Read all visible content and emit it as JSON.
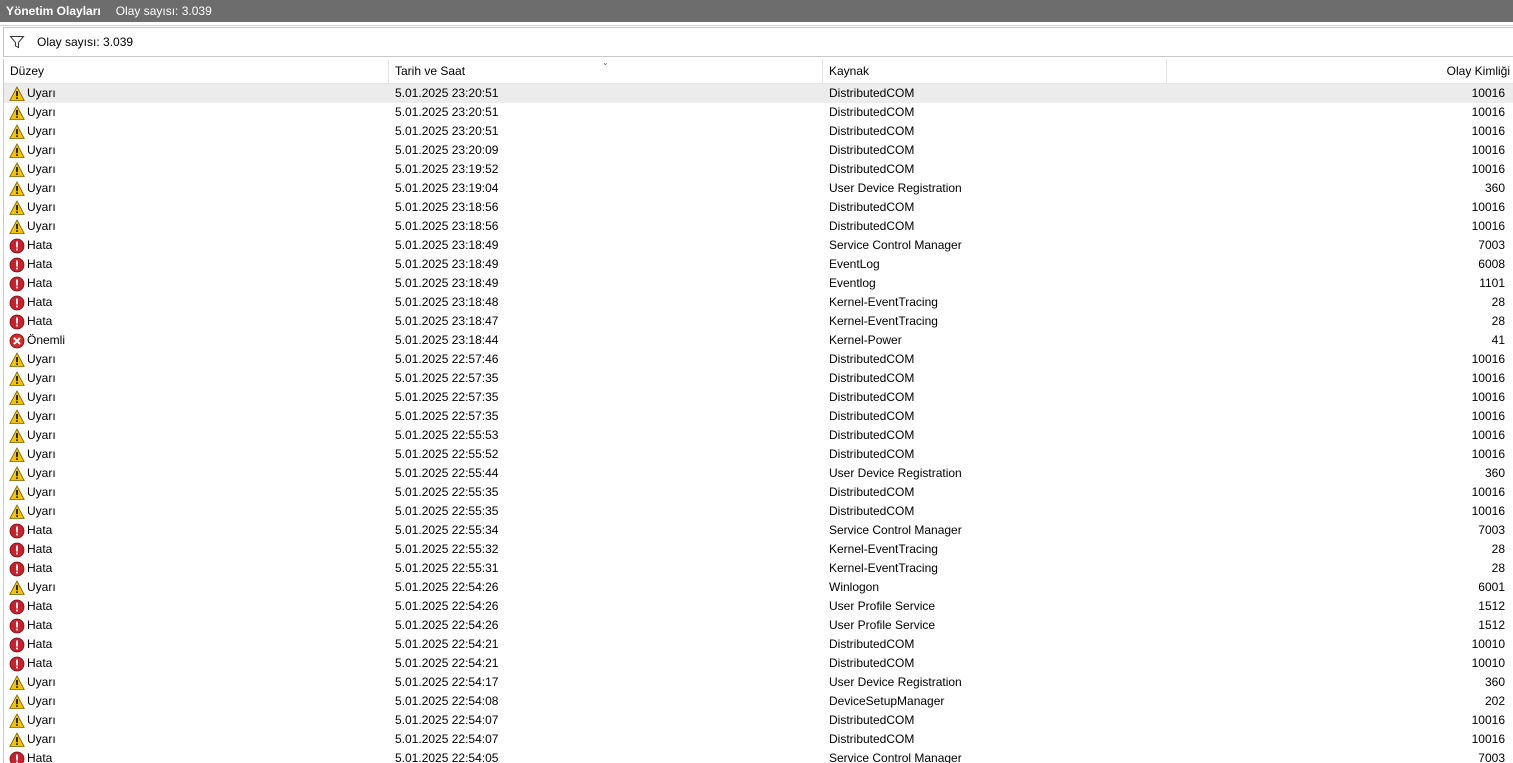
{
  "titlebar": {
    "title": "Yönetim Olayları",
    "count": "Olay sayısı: 3.039"
  },
  "filterbar": {
    "icon": "filter-icon",
    "text": "Olay sayısı: 3.039"
  },
  "columns": {
    "level": "Düzey",
    "date": "Tarih ve Saat",
    "source": "Kaynak",
    "id": "Olay Kimliği"
  },
  "icon_map": {
    "Uyarı": "warning",
    "Hata": "error",
    "Önemli": "critical"
  },
  "colors": {
    "warning": "#f5c400",
    "error": "#c8202c",
    "critical": "#d42a2a"
  },
  "rows": [
    {
      "level": "Uyarı",
      "date": "5.01.2025 23:20:51",
      "source": "DistributedCOM",
      "id": "10016"
    },
    {
      "level": "Uyarı",
      "date": "5.01.2025 23:20:51",
      "source": "DistributedCOM",
      "id": "10016"
    },
    {
      "level": "Uyarı",
      "date": "5.01.2025 23:20:51",
      "source": "DistributedCOM",
      "id": "10016"
    },
    {
      "level": "Uyarı",
      "date": "5.01.2025 23:20:09",
      "source": "DistributedCOM",
      "id": "10016"
    },
    {
      "level": "Uyarı",
      "date": "5.01.2025 23:19:52",
      "source": "DistributedCOM",
      "id": "10016"
    },
    {
      "level": "Uyarı",
      "date": "5.01.2025 23:19:04",
      "source": "User Device Registration",
      "id": "360"
    },
    {
      "level": "Uyarı",
      "date": "5.01.2025 23:18:56",
      "source": "DistributedCOM",
      "id": "10016"
    },
    {
      "level": "Uyarı",
      "date": "5.01.2025 23:18:56",
      "source": "DistributedCOM",
      "id": "10016"
    },
    {
      "level": "Hata",
      "date": "5.01.2025 23:18:49",
      "source": "Service Control Manager",
      "id": "7003"
    },
    {
      "level": "Hata",
      "date": "5.01.2025 23:18:49",
      "source": "EventLog",
      "id": "6008"
    },
    {
      "level": "Hata",
      "date": "5.01.2025 23:18:49",
      "source": "Eventlog",
      "id": "1101"
    },
    {
      "level": "Hata",
      "date": "5.01.2025 23:18:48",
      "source": "Kernel-EventTracing",
      "id": "28"
    },
    {
      "level": "Hata",
      "date": "5.01.2025 23:18:47",
      "source": "Kernel-EventTracing",
      "id": "28"
    },
    {
      "level": "Önemli",
      "date": "5.01.2025 23:18:44",
      "source": "Kernel-Power",
      "id": "41"
    },
    {
      "level": "Uyarı",
      "date": "5.01.2025 22:57:46",
      "source": "DistributedCOM",
      "id": "10016"
    },
    {
      "level": "Uyarı",
      "date": "5.01.2025 22:57:35",
      "source": "DistributedCOM",
      "id": "10016"
    },
    {
      "level": "Uyarı",
      "date": "5.01.2025 22:57:35",
      "source": "DistributedCOM",
      "id": "10016"
    },
    {
      "level": "Uyarı",
      "date": "5.01.2025 22:57:35",
      "source": "DistributedCOM",
      "id": "10016"
    },
    {
      "level": "Uyarı",
      "date": "5.01.2025 22:55:53",
      "source": "DistributedCOM",
      "id": "10016"
    },
    {
      "level": "Uyarı",
      "date": "5.01.2025 22:55:52",
      "source": "DistributedCOM",
      "id": "10016"
    },
    {
      "level": "Uyarı",
      "date": "5.01.2025 22:55:44",
      "source": "User Device Registration",
      "id": "360"
    },
    {
      "level": "Uyarı",
      "date": "5.01.2025 22:55:35",
      "source": "DistributedCOM",
      "id": "10016"
    },
    {
      "level": "Uyarı",
      "date": "5.01.2025 22:55:35",
      "source": "DistributedCOM",
      "id": "10016"
    },
    {
      "level": "Hata",
      "date": "5.01.2025 22:55:34",
      "source": "Service Control Manager",
      "id": "7003"
    },
    {
      "level": "Hata",
      "date": "5.01.2025 22:55:32",
      "source": "Kernel-EventTracing",
      "id": "28"
    },
    {
      "level": "Hata",
      "date": "5.01.2025 22:55:31",
      "source": "Kernel-EventTracing",
      "id": "28"
    },
    {
      "level": "Uyarı",
      "date": "5.01.2025 22:54:26",
      "source": "Winlogon",
      "id": "6001"
    },
    {
      "level": "Hata",
      "date": "5.01.2025 22:54:26",
      "source": "User Profile Service",
      "id": "1512"
    },
    {
      "level": "Hata",
      "date": "5.01.2025 22:54:26",
      "source": "User Profile Service",
      "id": "1512"
    },
    {
      "level": "Hata",
      "date": "5.01.2025 22:54:21",
      "source": "DistributedCOM",
      "id": "10010"
    },
    {
      "level": "Hata",
      "date": "5.01.2025 22:54:21",
      "source": "DistributedCOM",
      "id": "10010"
    },
    {
      "level": "Uyarı",
      "date": "5.01.2025 22:54:17",
      "source": "User Device Registration",
      "id": "360"
    },
    {
      "level": "Uyarı",
      "date": "5.01.2025 22:54:08",
      "source": "DeviceSetupManager",
      "id": "202"
    },
    {
      "level": "Uyarı",
      "date": "5.01.2025 22:54:07",
      "source": "DistributedCOM",
      "id": "10016"
    },
    {
      "level": "Uyarı",
      "date": "5.01.2025 22:54:07",
      "source": "DistributedCOM",
      "id": "10016"
    },
    {
      "level": "Hata",
      "date": "5.01.2025 22:54:05",
      "source": "Service Control Manager",
      "id": "7003"
    }
  ]
}
